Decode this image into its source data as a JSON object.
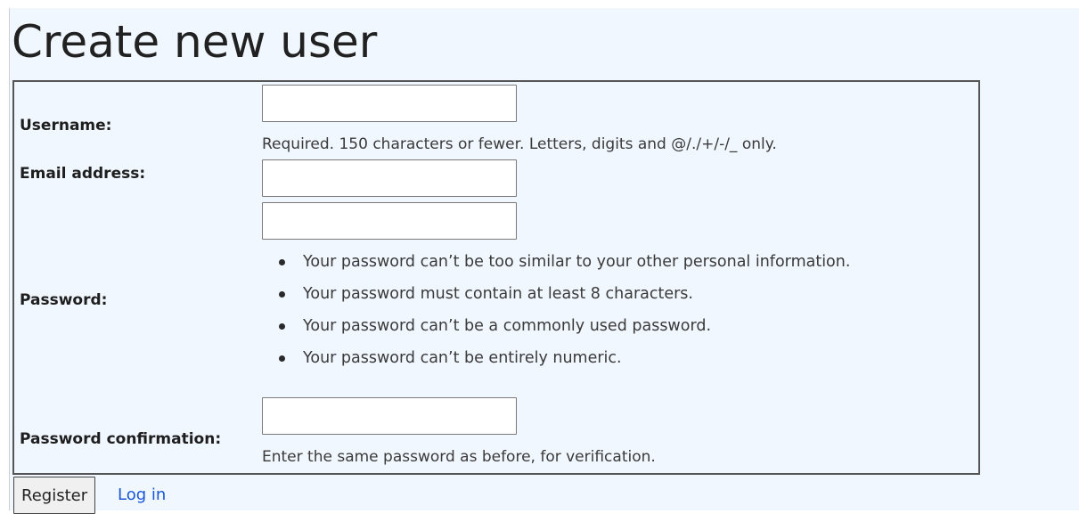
{
  "page": {
    "title": "Create new user"
  },
  "form": {
    "username": {
      "label": "Username:",
      "value": "",
      "help": "Required. 150 characters or fewer. Letters, digits and @/./+/-/_ only."
    },
    "email": {
      "label": "Email address:",
      "value": ""
    },
    "password": {
      "label": "Password:",
      "value": "",
      "requirements": [
        "Your password can’t be too similar to your other personal information.",
        "Your password must contain at least 8 characters.",
        "Your password can’t be a commonly used password.",
        "Your password can’t be entirely numeric."
      ]
    },
    "password_confirmation": {
      "label": "Password confirmation:",
      "value": "",
      "help": "Enter the same password as before, for verification."
    }
  },
  "actions": {
    "register_label": "Register",
    "login_label": "Log in"
  },
  "colors": {
    "page_background": "#f1f7fe",
    "link": "#1a57d8",
    "border": "#555555"
  }
}
